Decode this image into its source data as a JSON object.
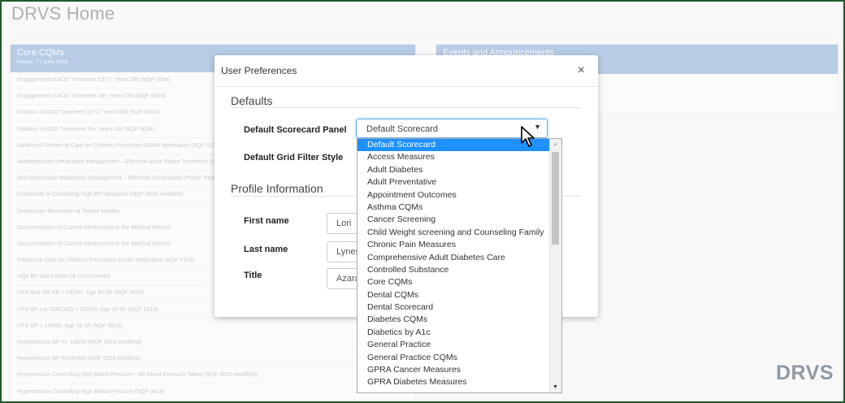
{
  "page": {
    "title": "DRVS Home",
    "logo": "DRVS"
  },
  "core_panel": {
    "title": "Core CQMs",
    "period": "Period: TY June 2018",
    "items": [
      "Engagement of AOD Treatment 13-17 Years Old (NQF 0004)",
      "Engagement of AOD Treatment 18+ Years Old (NQF 0004)",
      "Initiation of AOD Treatment 13-17 Years Old (NQF 0004)",
      "Initiation of AOD Treatment 18+ Years Old (NQF 0004)",
      "Additional Follow-Up Care for Children Prescribed ADHD Medication (NQF 0108)",
      "Antidepressant Medication Management – Effective Acute Phase Treatment (NQF 0105)",
      "Anti-Depressant Medication Management – Effective Continuation Phase Treatment (NQF 0105)",
      "Composite of Controlling High BP Measures (NQF 0018 modified)",
      "Depression Remission at Twelve Months",
      "Documentation of Current Medications in the Medical Record",
      "Documentation of Current Medications in the Medical Record",
      "Follow-Up Care for Children Prescribed ADHD Medication (NQF 0108)",
      "High BP and Follow-Up Documented",
      "HTN and DM BP < 140/90, Age 60-85 (NQF 0018)",
      "HTN BP (no DM/CKD) < 150/90, Age 60-85 (NQF 0018)",
      "HTN BP < 140/90, Age 18-59 (NQF 0018)",
      "Hypertension BP >= 140/90 (NQF 0018 modified)",
      "Hypertension BP Recorded (NQF 0018 modified)",
      "Hypertension Controlling High Blood Pressure - No Blood Pressure Taken (NQF 0018 modified)",
      "Hypertension Controlling High Blood Pressure (NQF 0018)"
    ]
  },
  "events_panel": {
    "title": "Events and Announcements"
  },
  "modal": {
    "title": "User Preferences",
    "close": "×",
    "defaults_heading": "Defaults",
    "scorecard_label": "Default Scorecard Panel",
    "scorecard_value": "Default Scorecard",
    "grid_filter_label": "Default Grid Filter Style",
    "profile_heading": "Profile Information",
    "first_name_label": "First name",
    "first_name_value": "Lori",
    "last_name_label": "Last name",
    "last_name_value": "Lynes",
    "title_label": "Title",
    "title_value": "Azara"
  },
  "dropdown": {
    "selected_index": 0,
    "options": [
      "Default Scorecard",
      "Access Measures",
      "Adult Diabetes",
      "Adult Preventative",
      "Appointment Outcomes",
      "Asthma CQMs",
      "Cancer Screening",
      "Child Weight screening and Counseling Family",
      "Chronic Pain Measures",
      "Comprehensive Adult Diabetes Care",
      "Controlled Substance",
      "Core CQMs",
      "Dental CQMs",
      "Dental Scorecard",
      "Diabetes CQMs",
      "Diabetics by A1c",
      "General Practice",
      "General Practice CQMs",
      "GPRA Cancer Measures",
      "GPRA Diabetes Measures"
    ]
  },
  "icons": {
    "close": "close-icon",
    "caret": "chevron-down-icon",
    "cursor": "mouse-pointer-icon"
  },
  "colors": {
    "panel_header": "#7ea3cf",
    "selected_option": "#1e90ff",
    "logo": "#34465c",
    "frame_border": "#1f5a2a"
  }
}
